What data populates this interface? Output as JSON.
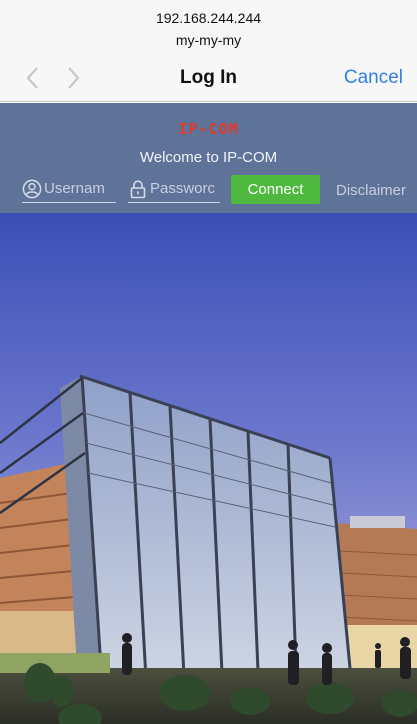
{
  "address_bar": {
    "host": "192.168.244.244",
    "ssid": "my-my-my"
  },
  "nav": {
    "title": "Log In",
    "cancel_label": "Cancel"
  },
  "portal": {
    "logo_text": "IP-COM",
    "welcome_text": "Welcome to IP-COM",
    "username_placeholder": "Usernam",
    "password_placeholder": "Passworс",
    "connect_label": "Connect",
    "disclaimer_label": "Disclaimer"
  },
  "colors": {
    "banner": "#5f7298",
    "connect": "#4fb93f",
    "link": "#2f7fe8",
    "logo": "#e23a2e"
  },
  "icons": [
    "chevron-left-icon",
    "chevron-right-icon",
    "user-icon",
    "lock-icon"
  ]
}
